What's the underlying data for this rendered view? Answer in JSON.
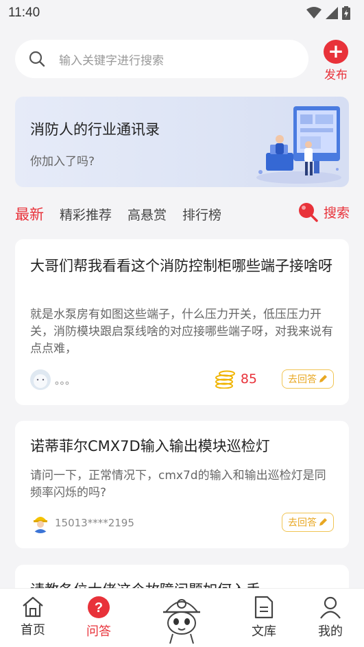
{
  "status": {
    "time": "11:40"
  },
  "search": {
    "placeholder": "输入关键字进行搜索"
  },
  "publish": {
    "label": "发布"
  },
  "banner": {
    "title": "消防人的行业通讯录",
    "subtitle": "你加入了吗?"
  },
  "tabs": [
    {
      "label": "最新",
      "active": true
    },
    {
      "label": "精彩推荐"
    },
    {
      "label": "高悬赏"
    },
    {
      "label": "排行榜"
    }
  ],
  "tab_search_label": "搜索",
  "posts": [
    {
      "title": "大哥们帮我看看这个消防控制柜哪些端子接啥呀",
      "body": "就是水泵房有如图这些端子，什么压力开关，低压压力开关，消防模块跟启泵线啥的对应接哪些端子呀，对我来说有点点难，",
      "user": "。。。",
      "reward": "85",
      "answer_label": "去回答"
    },
    {
      "title": "诺蒂菲尔CMX7D输入输出模块巡检灯",
      "body": "请问一下，正常情况下，cmx7d的输入和输出巡检灯是同频率闪烁的吗?",
      "user": "15013****2195",
      "answer_label": "去回答"
    },
    {
      "title": "请教各位大佬这个故障问题如何入手"
    }
  ],
  "nav": [
    {
      "label": "首页",
      "icon": "home-icon"
    },
    {
      "label": "问答",
      "icon": "question-icon",
      "active": true
    },
    {
      "label": "",
      "icon": "firefighter-mascot-icon"
    },
    {
      "label": "文库",
      "icon": "document-icon"
    },
    {
      "label": "我的",
      "icon": "user-icon"
    }
  ],
  "colors": {
    "accent": "#e8323a",
    "gold": "#e8a722",
    "background": "#f4f4f6"
  }
}
